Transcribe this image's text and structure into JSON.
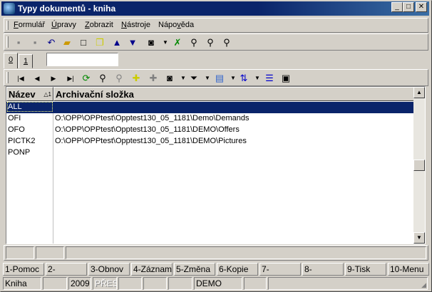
{
  "window": {
    "title": "Typy dokumentů - kniha",
    "minimize": "_",
    "maximize": "□",
    "close": "✕"
  },
  "menu": [
    {
      "pre": "",
      "u": "F",
      "post": "ormulář"
    },
    {
      "pre": "",
      "u": "Ú",
      "post": "pravy"
    },
    {
      "pre": "",
      "u": "Z",
      "post": "obrazit"
    },
    {
      "pre": "",
      "u": "N",
      "post": "ástroje"
    },
    {
      "pre": "Nápo",
      "u": "v",
      "post": "ěda"
    }
  ],
  "tabs": [
    {
      "label": "0"
    },
    {
      "label": "1"
    }
  ],
  "tab_input": {
    "value": ""
  },
  "grid": {
    "columns": [
      "Název",
      "Archivační složka"
    ],
    "sort_indicator": "△1",
    "rows": [
      [
        "ALL",
        ""
      ],
      [
        "OFI",
        "O:\\OPP\\OPPtest\\Opptest130_05_1181\\Demo\\Demands"
      ],
      [
        "OFO",
        "O:\\OPP\\OPPtest\\Opptest130_05_1181\\DEMO\\Offers"
      ],
      [
        "PICTK2",
        "O:\\OPP\\OPPtest\\Opptest130_05_1181\\DEMO\\Pictures"
      ],
      [
        "PONP",
        ""
      ]
    ]
  },
  "fkeys": [
    "1-Pomoc",
    "2-",
    "3-Obnov",
    "4-Záznam",
    "5-Změna",
    "6-Kopie",
    "7-",
    "8-",
    "9-Tisk",
    "10-Menu"
  ],
  "status": [
    "Kniha",
    "",
    "2009",
    "PŘES",
    "",
    "",
    "",
    "DEMO",
    "",
    ""
  ],
  "colors": {
    "title": "#0a246a",
    "selection": "#0a246a"
  }
}
